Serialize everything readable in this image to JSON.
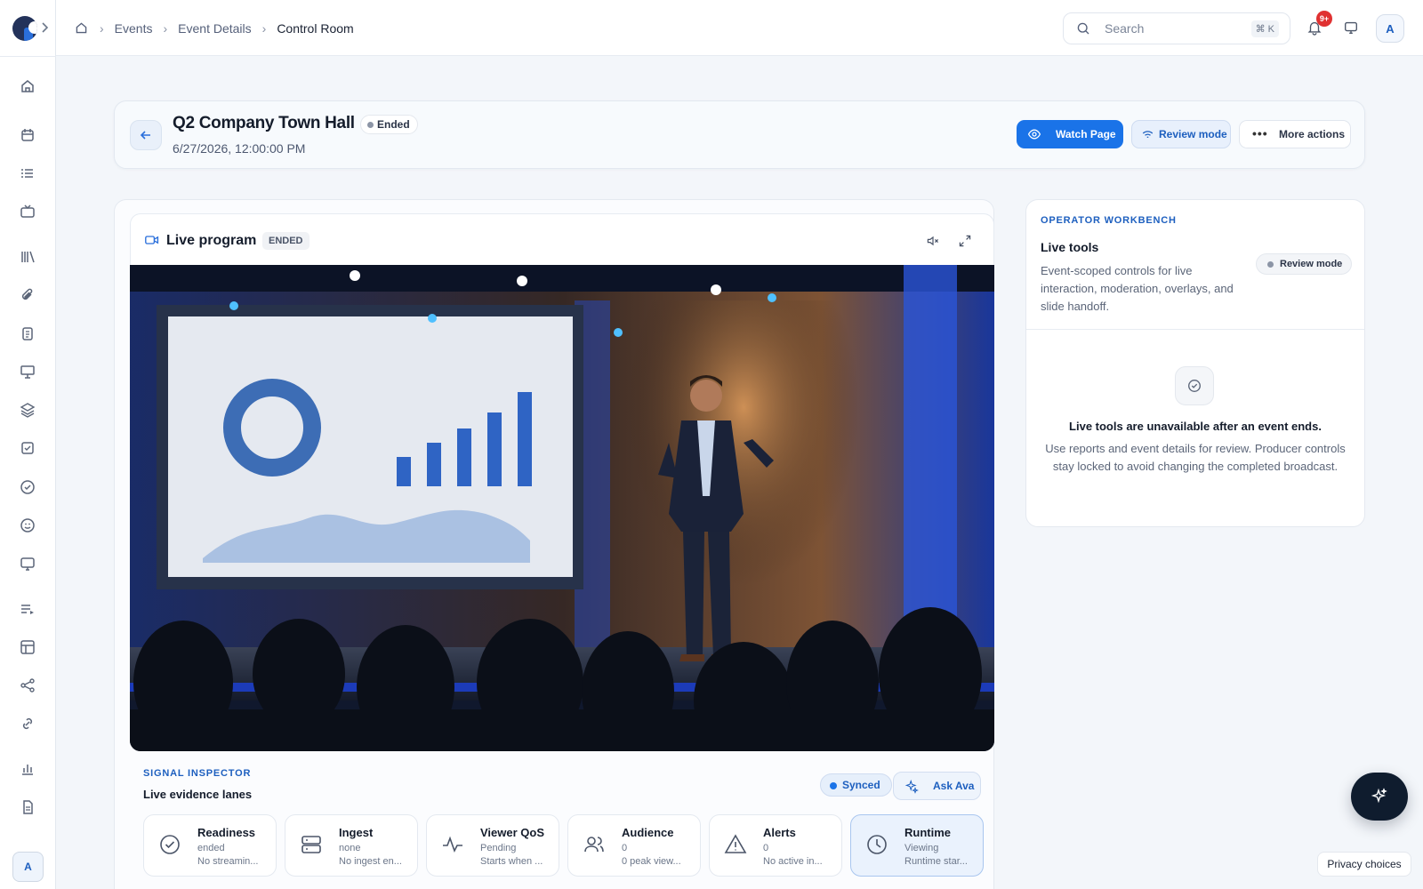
{
  "breadcrumb": {
    "items": [
      "Events",
      "Event Details"
    ],
    "current": "Control Room"
  },
  "search": {
    "placeholder": "Search",
    "shortcut": "⌘ K"
  },
  "notifications": {
    "count": "9+"
  },
  "user": {
    "initial": "A"
  },
  "event": {
    "title": "Q2 Company Town Hall",
    "status": "Ended",
    "datetime": "6/27/2026, 12:00:00 PM"
  },
  "actions": {
    "watch": "Watch Page",
    "review": "Review mode",
    "more": "More actions"
  },
  "program": {
    "title": "Live program",
    "status": "ENDED"
  },
  "signal": {
    "label": "SIGNAL INSPECTOR",
    "title": "Live evidence lanes",
    "synced": "Synced",
    "ask": "Ask Ava",
    "lanes": [
      {
        "title": "Readiness",
        "status": "ended",
        "detail": "No streamin...",
        "icon": "check-circle-icon"
      },
      {
        "title": "Ingest",
        "status": "none",
        "detail": "No ingest en...",
        "icon": "server-icon"
      },
      {
        "title": "Viewer QoS",
        "status": "Pending",
        "detail": "Starts when ...",
        "icon": "pulse-icon"
      },
      {
        "title": "Audience",
        "status": "0",
        "detail": "0 peak view...",
        "icon": "users-icon"
      },
      {
        "title": "Alerts",
        "status": "0",
        "detail": "No active in...",
        "icon": "alert-triangle-icon"
      },
      {
        "title": "Runtime",
        "status": "Viewing",
        "detail": "Runtime star...",
        "icon": "clock-icon"
      }
    ]
  },
  "workbench": {
    "label": "OPERATOR WORKBENCH",
    "title": "Live tools",
    "description": "Event-scoped controls for live interaction, moderation, overlays, and slide handoff.",
    "mode": "Review mode",
    "unavailable_title": "Live tools are unavailable after an event ends.",
    "unavailable_desc": "Use reports and event details for review. Producer controls stay locked to avoid changing the completed broadcast."
  },
  "privacy": "Privacy choices",
  "colors": {
    "accent": "#1a73e8",
    "fab": "#0f1c2e",
    "badge": "#e03131"
  }
}
